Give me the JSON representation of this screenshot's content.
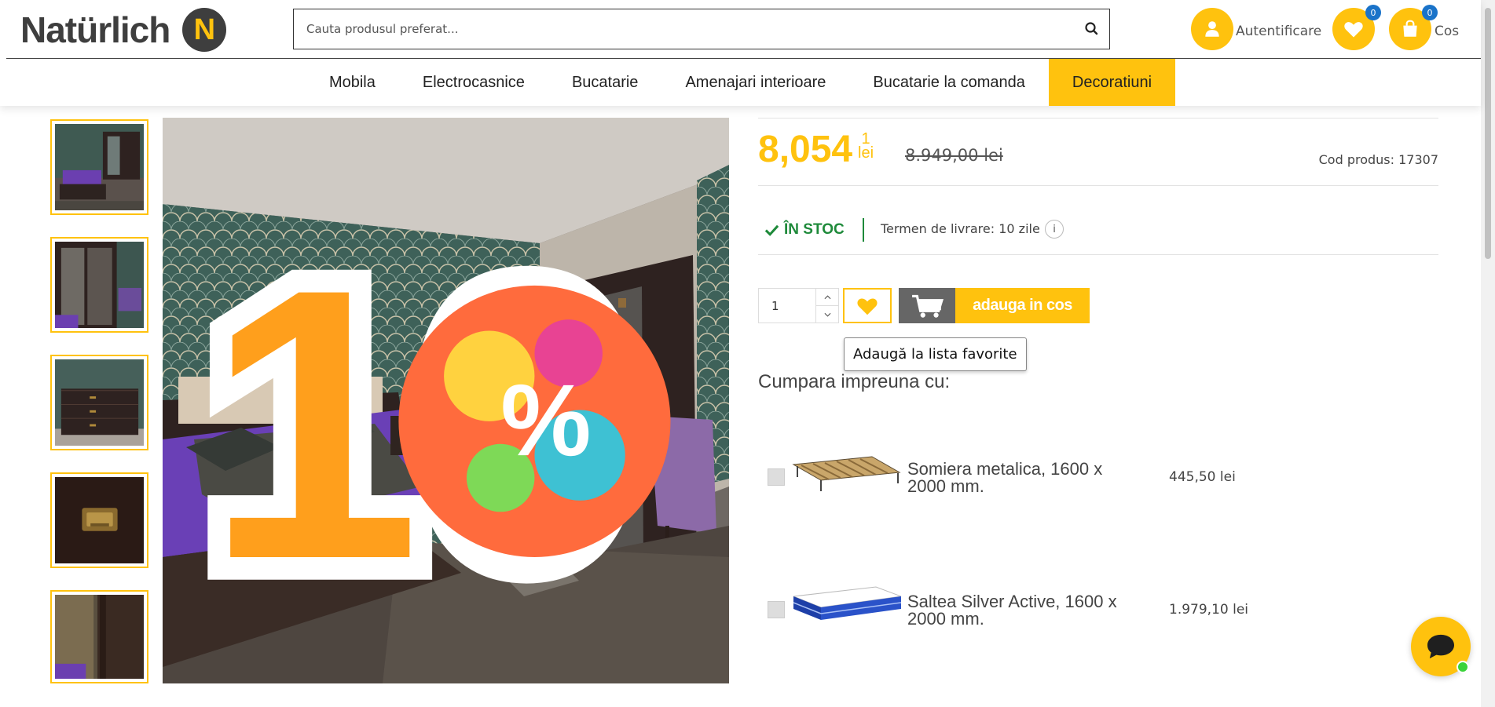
{
  "brand": {
    "logo_text": "Natürlich",
    "logo_letter": "N"
  },
  "search": {
    "placeholder": "Cauta produsul preferat..."
  },
  "header": {
    "login_label": "Autentificare",
    "wishlist_count": "0",
    "cart_count": "0",
    "cart_label": "Cos"
  },
  "nav": {
    "items": [
      "Mobila",
      "Electrocasnice",
      "Bucatarie",
      "Amenajari interioare",
      "Bucatarie la comanda",
      "Decoratiuni"
    ],
    "active_index": 5
  },
  "gallery": {
    "thumbnails": [
      "bedroom-full-view",
      "wardrobe-vanity-view",
      "dresser-view",
      "drawer-handle-closeup",
      "wardrobe-door-closeup"
    ],
    "badge_text": "10"
  },
  "product": {
    "price_main": "8,054",
    "price_decimal": "1",
    "price_currency": "lei",
    "price_old": "8.949,00 lei",
    "code": "Cod produs: 17307",
    "stock": "ÎN STOC",
    "delivery": "Termen de livrare: 10 zile",
    "info_symbol": "i",
    "quantity": "1",
    "add_to_cart": "adauga in cos",
    "favorite_tooltip": "Adaugă la lista favorite"
  },
  "bundle": {
    "title": "Cumpara impreuna cu:",
    "items": [
      {
        "name": "Somiera metalica, 1600 x 2000 mm.",
        "price": "445,50 lei"
      },
      {
        "name": "Saltea Silver Active, 1600 x 2000 mm.",
        "price": "1.979,10 lei"
      }
    ]
  },
  "colors": {
    "accent": "#ffc20e",
    "stock_green": "#1e8a3a",
    "badge_blue": "#1a73c9",
    "dark": "#3e3e3e"
  }
}
